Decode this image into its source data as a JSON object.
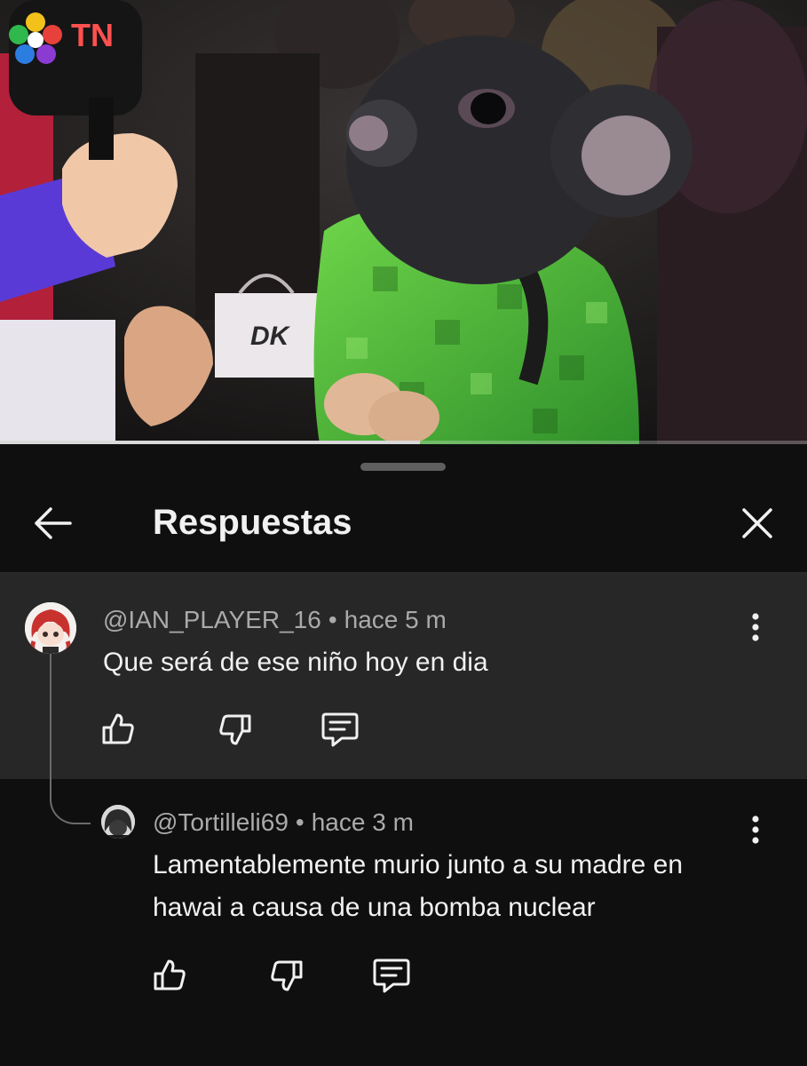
{
  "video": {
    "channel_logo": "TN",
    "bag_logo": "DK",
    "progress_fraction": 0.52
  },
  "panel": {
    "title": "Respuestas",
    "back_icon": "arrow-left-icon",
    "close_icon": "close-icon"
  },
  "comments": [
    {
      "username": "@IAN_PLAYER_16",
      "separator": "•",
      "time": "hace 5 m",
      "text": "Que será de ese niño hoy en dia",
      "actions": [
        "thumbs-up-icon",
        "thumbs-down-icon",
        "reply-icon"
      ]
    },
    {
      "username": "@Tortilleli69",
      "separator": "•",
      "time": "hace 3 m",
      "text_lines": [
        "Lamentablemente murio junto a su madre en",
        "hawai a causa de una bomba nuclear"
      ],
      "actions": [
        "thumbs-up-icon",
        "thumbs-down-icon",
        "reply-icon"
      ]
    }
  ],
  "colors": {
    "background": "#0f0f0f",
    "highlight": "#272727",
    "meta_text": "#aaaaaa",
    "primary_text": "#f1f1f1"
  }
}
